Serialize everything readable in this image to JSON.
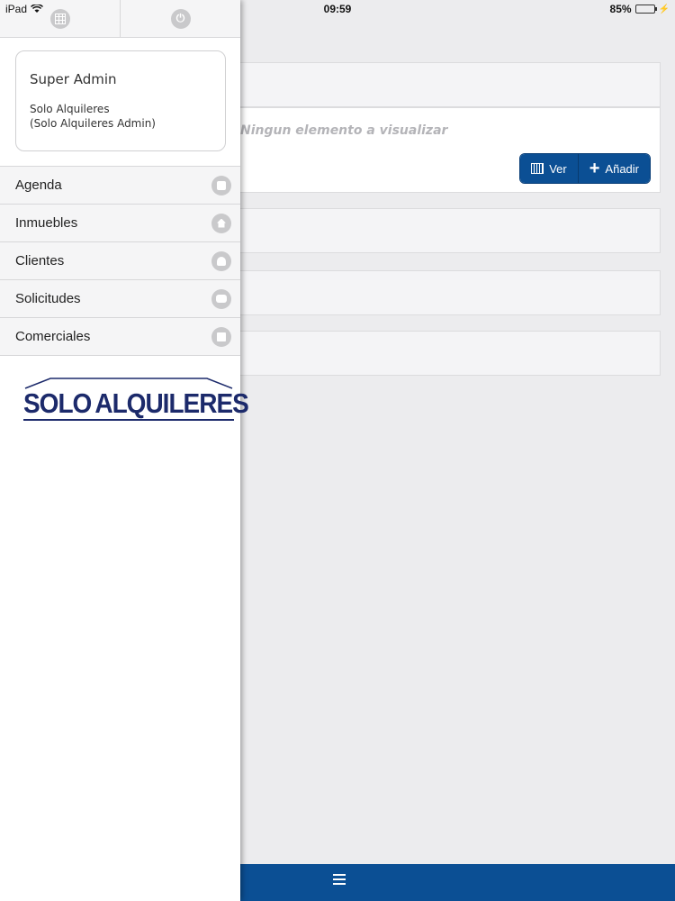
{
  "status_bar": {
    "device": "iPad",
    "time": "09:59",
    "battery": "85%",
    "battery_level": 0.85
  },
  "drawer": {
    "user": {
      "name": "Super Admin",
      "organization": "Solo Alquileres",
      "role": "(Solo Alquileres Admin)"
    },
    "menu": [
      {
        "label": "Agenda",
        "icon": "calendar-icon"
      },
      {
        "label": "Inmuebles",
        "icon": "house-icon"
      },
      {
        "label": "Clientes",
        "icon": "person-icon"
      },
      {
        "label": "Solicitudes",
        "icon": "chat-icon"
      },
      {
        "label": "Comerciales",
        "icon": "briefcase-icon"
      }
    ],
    "logo": {
      "left": "SOLO",
      "right": "ALQUILERES"
    }
  },
  "main": {
    "empty_message": "Ningun elemento a visualizar",
    "view_button": "Ver",
    "add_button": "Añadir"
  },
  "colors": {
    "primary": "#0b4f94",
    "logo": "#1c2a6b",
    "icon_gray": "#c9c9cb"
  }
}
